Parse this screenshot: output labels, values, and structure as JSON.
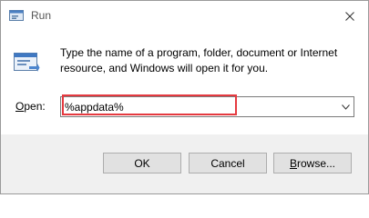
{
  "window": {
    "title": "Run",
    "icons": {
      "title": "run-icon",
      "close": "close-icon",
      "content": "run-icon"
    }
  },
  "dialog": {
    "description": "Type the name of a program, folder, document or Internet resource, and Windows will open it for you.",
    "open_label_mnemonic": "O",
    "open_label_rest": "pen:",
    "input_value": "%appdata%"
  },
  "buttons": {
    "ok": "OK",
    "cancel": "Cancel",
    "browse_mnemonic": "B",
    "browse_rest": "rowse..."
  },
  "colors": {
    "highlight": "#e53a40",
    "footer": "#f0f0f0"
  }
}
